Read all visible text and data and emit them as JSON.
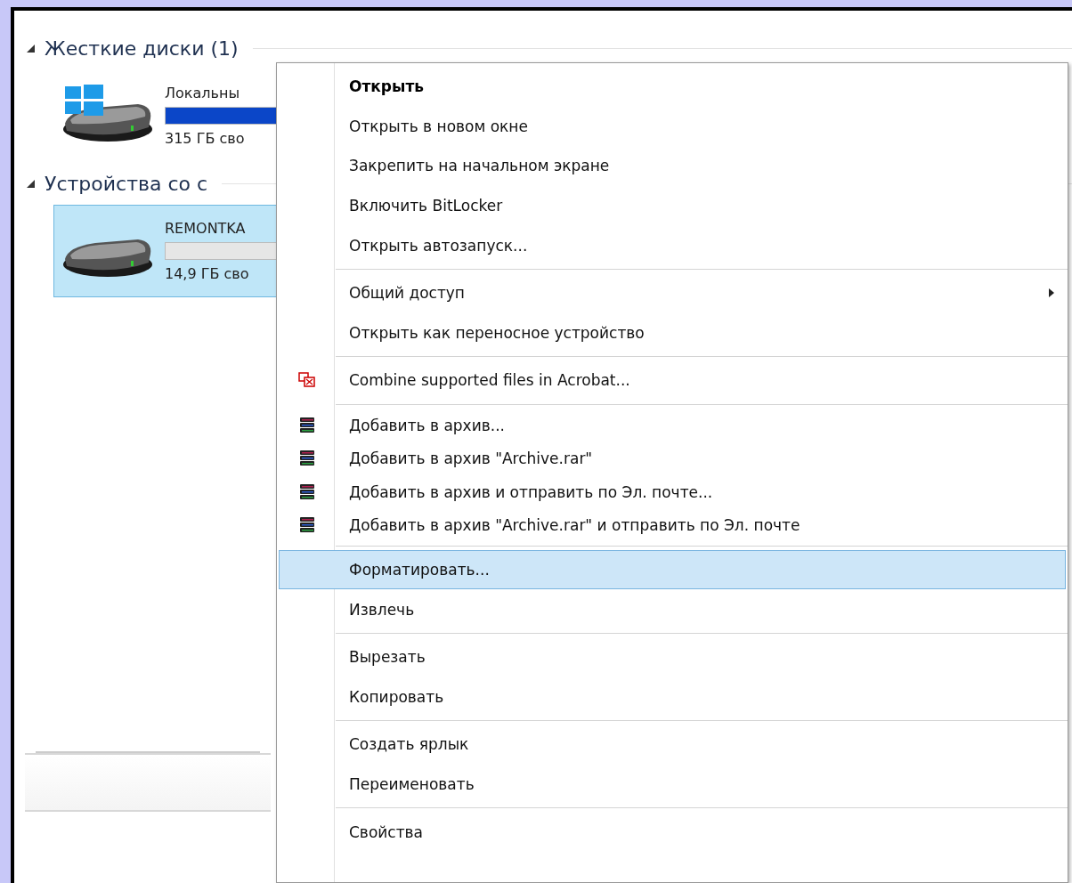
{
  "groups": [
    {
      "title": "Жесткие диски (1)",
      "expanded": true,
      "drives": [
        {
          "kind": "system",
          "name": "Локальны",
          "free": "315 ГБ сво",
          "level": 1,
          "selected": false
        }
      ]
    },
    {
      "title": "Устройства со с",
      "expanded": true,
      "drives": [
        {
          "kind": "removable",
          "name": "REMONTKA",
          "free": "14,9 ГБ сво",
          "selected": true
        }
      ]
    }
  ],
  "context_menu": {
    "sections": [
      {
        "items": [
          {
            "label": "Открыть",
            "default": true,
            "selected": false
          },
          {
            "label": "Открыть в новом окне",
            "default": false,
            "selected": false
          },
          {
            "label": "Закрепить на начальном экране",
            "default": false,
            "selected": false
          },
          {
            "label": "Включить BitLocker",
            "default": false,
            "selected": false
          },
          {
            "label": "Открыть автозапуск...",
            "default": false,
            "selected": false
          }
        ]
      },
      {
        "items": [
          {
            "label": "Общий доступ",
            "default": false,
            "selected": false,
            "submenu": true
          },
          {
            "label": "Открыть как переносное устройство",
            "default": false,
            "selected": false
          }
        ]
      },
      {
        "items": [
          {
            "kind": "acrobat",
            "label": "Combine supported files in Acrobat...",
            "default": false,
            "selected": false
          }
        ]
      },
      {
        "items": [
          {
            "kind": "archive",
            "label": "Добавить в архив...",
            "default": false,
            "selected": false
          },
          {
            "kind": "archive",
            "label": "Добавить в архив \"Archive.rar\"",
            "default": false,
            "selected": false
          },
          {
            "kind": "archive",
            "label": "Добавить в архив и отправить по Эл. почте...",
            "default": false,
            "selected": false
          },
          {
            "kind": "archive",
            "label": "Добавить в архив \"Archive.rar\" и отправить по Эл. почте",
            "default": false,
            "selected": false
          }
        ]
      },
      {
        "items": [
          {
            "label": "Форматировать...",
            "default": false,
            "selected": true
          },
          {
            "label": "Извлечь",
            "default": false,
            "selected": false
          }
        ]
      },
      {
        "items": [
          {
            "label": "Вырезать",
            "default": false,
            "selected": false
          },
          {
            "label": "Копировать",
            "default": false,
            "selected": false
          }
        ]
      },
      {
        "items": [
          {
            "label": "Создать ярлык",
            "default": false,
            "selected": false
          },
          {
            "label": "Переименовать",
            "default": false,
            "selected": false
          }
        ]
      },
      {
        "items": [
          {
            "label": "Свойства",
            "default": false,
            "selected": false
          }
        ]
      }
    ]
  }
}
